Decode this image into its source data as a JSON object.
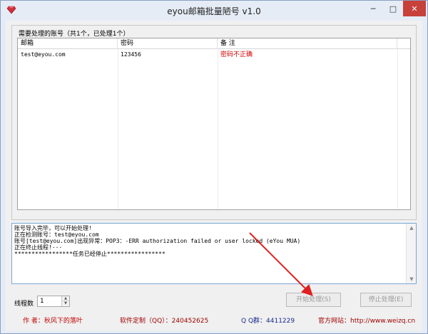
{
  "window": {
    "title": "eyou邮箱批量陋号 v1.0"
  },
  "titlebar_buttons": {
    "minimize": "─",
    "maximize": "□",
    "close": "✕"
  },
  "accounts_group": {
    "title": "需要处理的账号（共1个，已处理1个）"
  },
  "accounts_table": {
    "columns": [
      "邮箱",
      "密码",
      "备 注"
    ],
    "rows": [
      {
        "email": "test@eyou.com",
        "password": "123456",
        "status": "密码不正确"
      }
    ]
  },
  "log": {
    "lines": [
      "账号导入完毕，可以开始处理!",
      "正在检测账号：test@eyou.com",
      "账号[test@eyou.com]出现异常：POP3：-ERR authorization failed or user locked (eYou MUA)",
      "正在终止线程!···",
      "*****************任务已经停止*****************"
    ]
  },
  "threads": {
    "label": "线程数",
    "value": "1"
  },
  "buttons": {
    "start": "开始处理(S)",
    "stop": "停止处理(E)"
  },
  "footer": {
    "author": "作 者：秋风下的落叶",
    "custom": "软件定制（QQ）：240452625",
    "qgroup": "Q Q群：4411229",
    "site": "官方网站：http://www.weizq.cn"
  },
  "colors": {
    "accent_red": "#c00000",
    "annotation_arrow": "#e02020"
  },
  "icons": {
    "app": "ruby-icon"
  }
}
